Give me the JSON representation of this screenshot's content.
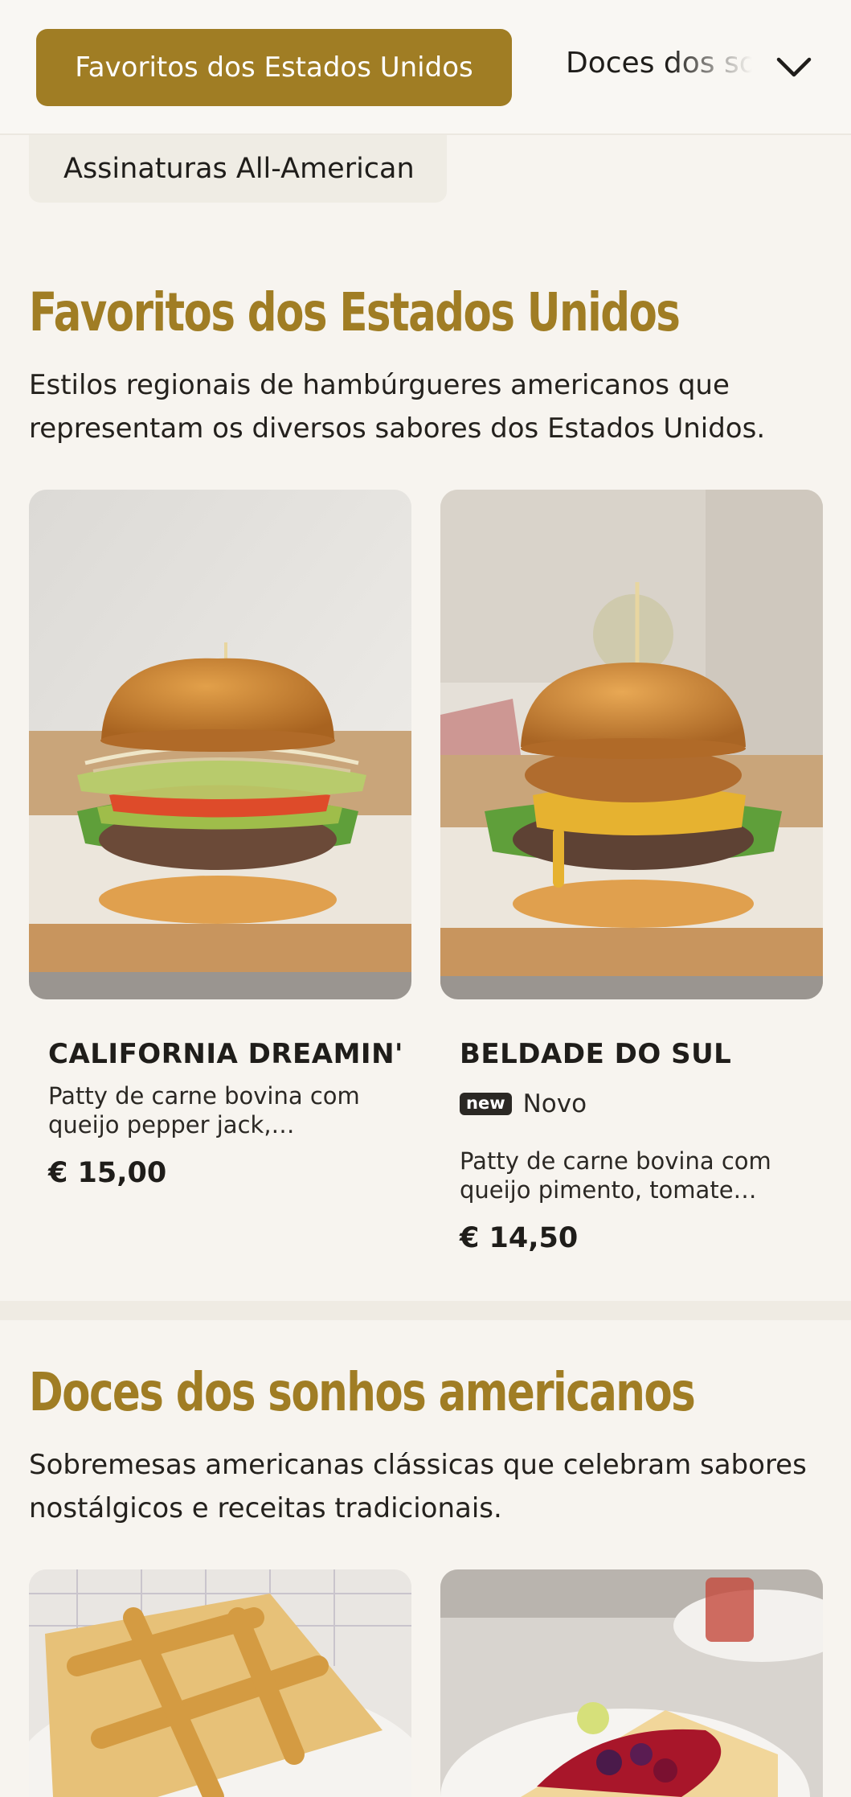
{
  "nav": {
    "active_category": "Favoritos dos Estados Unidos",
    "next_category": "Doces dos sonhos americanos",
    "second_category": "Assinaturas All-American",
    "chevron_icon": "chevron-down-icon"
  },
  "sections": [
    {
      "title": "Favoritos dos Estados Unidos",
      "description": "Estilos regionais de hambúrgueres americanos que representam os diversos sabores dos Estados Unidos.",
      "products": [
        {
          "name": "CALIFORNIA DREAMIN'",
          "description": "Patty de carne bovina com queijo pepper jack, abacate,...",
          "price": "€ 15,00"
        },
        {
          "name": "BELDADE DO SUL",
          "badge": "new",
          "badge_label": "Novo",
          "description": "Patty de carne bovina com queijo pimento, tomate verd...",
          "price": "€ 14,50"
        }
      ]
    },
    {
      "title": "Doces dos sonhos americanos",
      "description": "Sobremesas americanas clássicas que celebram sabores nostálgicos e receitas tradicionais."
    }
  ],
  "colors": {
    "accent": "#a07d24",
    "background": "#f7f4ef",
    "text": "#1f1d1a"
  }
}
